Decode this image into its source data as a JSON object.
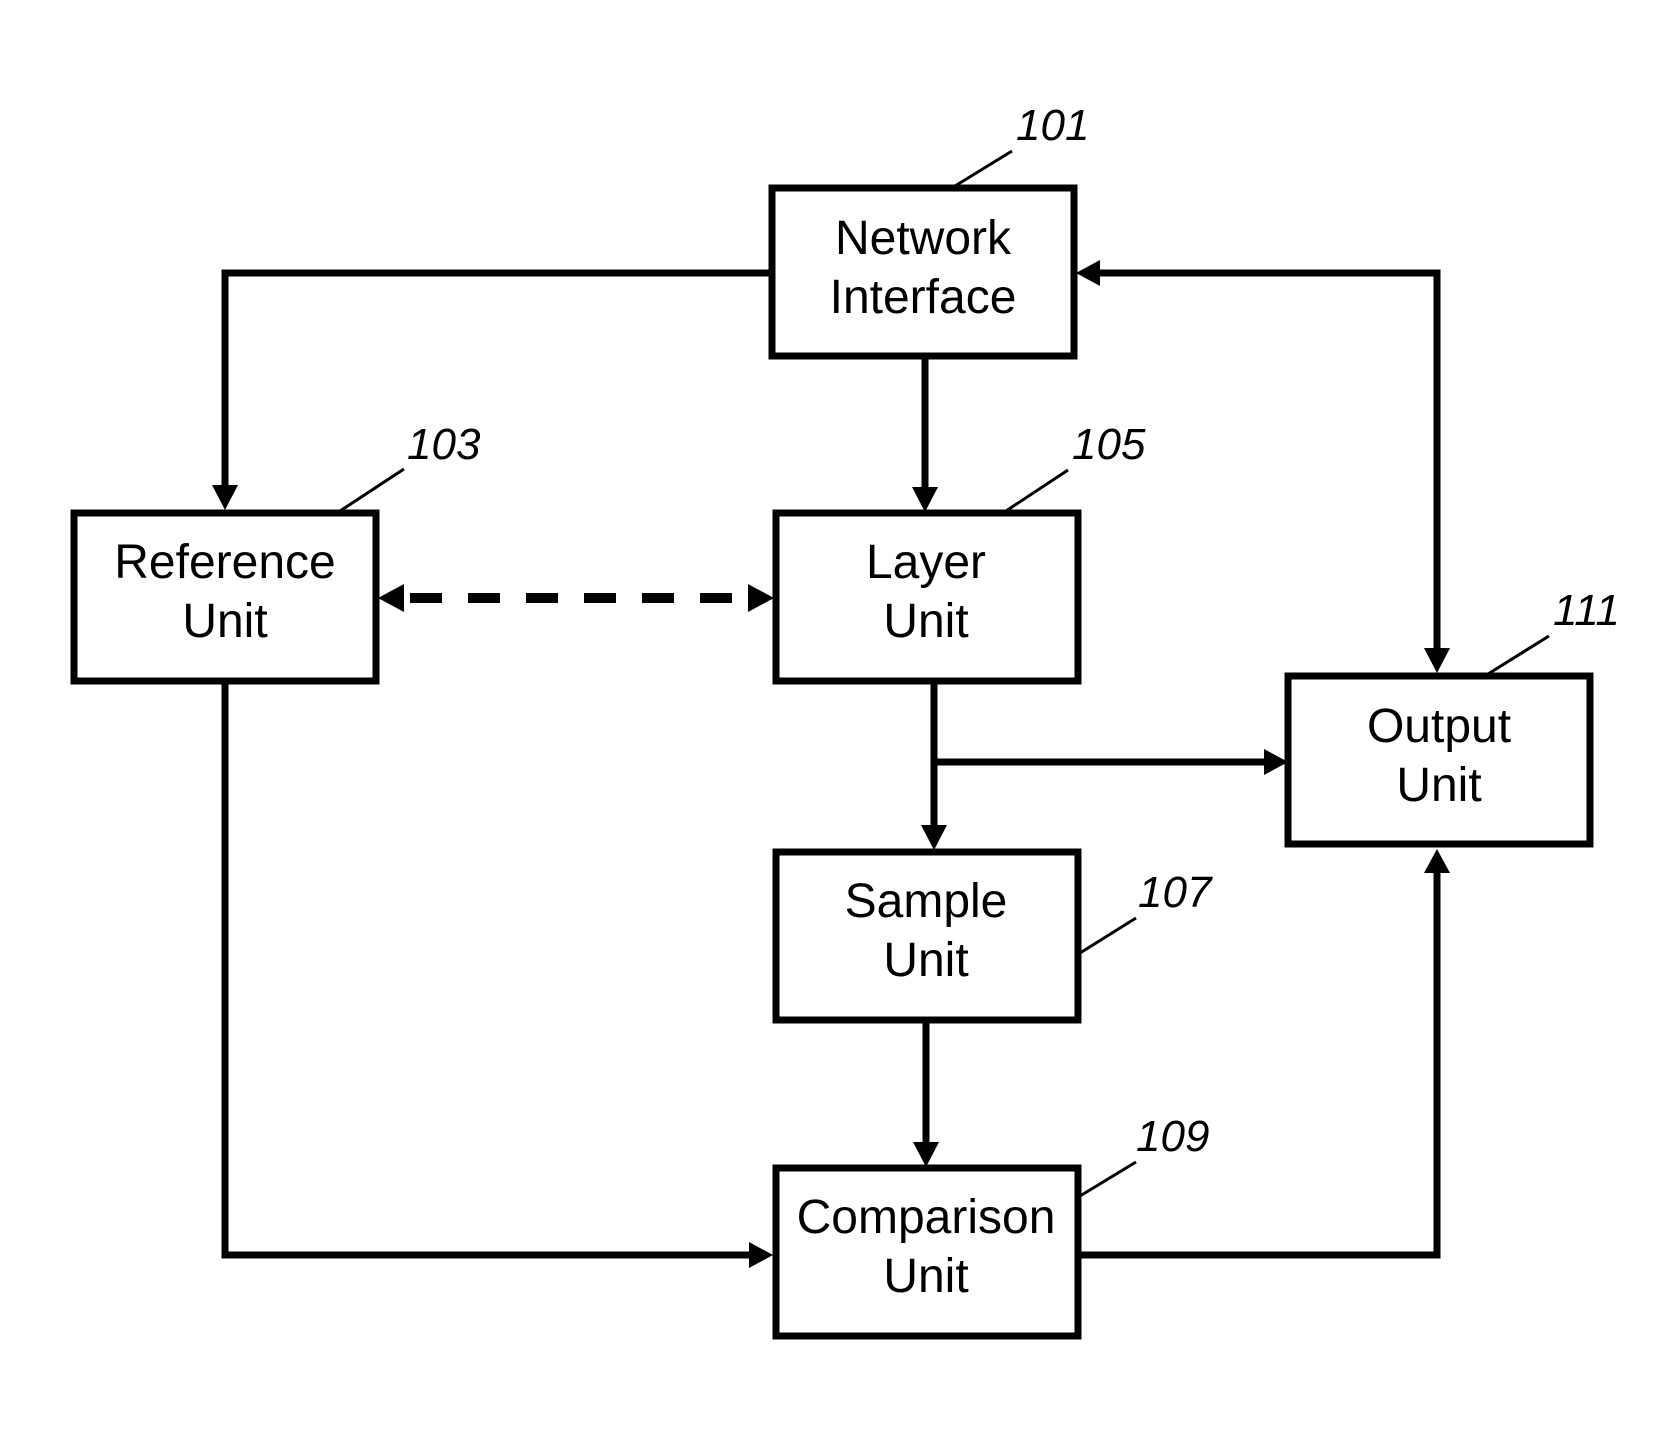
{
  "diagram": {
    "type": "block-diagram",
    "colors": {
      "stroke": "#000000",
      "background": "#ffffff"
    },
    "nodes": [
      {
        "id": "network_interface",
        "ref": "101",
        "lines": [
          "Network",
          "Interface"
        ]
      },
      {
        "id": "reference_unit",
        "ref": "103",
        "lines": [
          "Reference",
          "Unit"
        ]
      },
      {
        "id": "layer_unit",
        "ref": "105",
        "lines": [
          "Layer",
          "Unit"
        ]
      },
      {
        "id": "sample_unit",
        "ref": "107",
        "lines": [
          "Sample",
          "Unit"
        ]
      },
      {
        "id": "comparison_unit",
        "ref": "109",
        "lines": [
          "Comparison",
          "Unit"
        ]
      },
      {
        "id": "output_unit",
        "ref": "111",
        "lines": [
          "Output",
          "Unit"
        ]
      }
    ],
    "edges": [
      {
        "from": "network_interface",
        "to": "reference_unit",
        "style": "solid",
        "arrow": "end"
      },
      {
        "from": "network_interface",
        "to": "layer_unit",
        "style": "solid",
        "arrow": "end"
      },
      {
        "from": "output_unit",
        "to": "network_interface",
        "style": "solid",
        "arrow": "both"
      },
      {
        "from": "reference_unit",
        "to": "layer_unit",
        "style": "dashed",
        "arrow": "both"
      },
      {
        "from": "layer_unit",
        "to": "sample_unit",
        "style": "solid",
        "arrow": "end"
      },
      {
        "from": "layer_unit",
        "to": "output_unit",
        "style": "solid",
        "arrow": "end"
      },
      {
        "from": "sample_unit",
        "to": "comparison_unit",
        "style": "solid",
        "arrow": "end"
      },
      {
        "from": "reference_unit",
        "to": "comparison_unit",
        "style": "solid",
        "arrow": "end"
      },
      {
        "from": "comparison_unit",
        "to": "output_unit",
        "style": "solid",
        "arrow": "end"
      }
    ]
  }
}
